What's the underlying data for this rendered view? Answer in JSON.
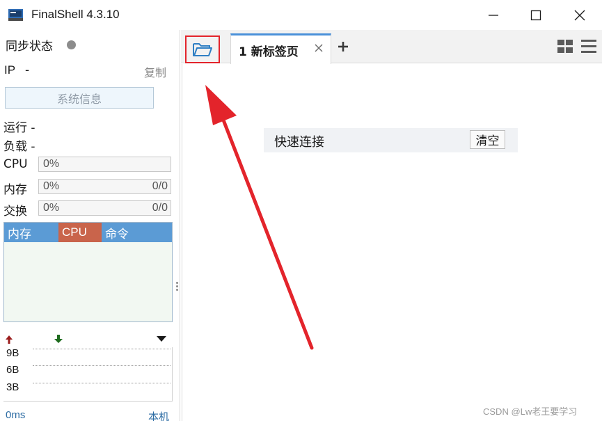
{
  "window": {
    "title": "FinalShell 4.3.10",
    "app_icon": "terminal-monitor-icon"
  },
  "left": {
    "sync_label": "同步状态",
    "sync_status_color": "#8c8c8c",
    "ip_label": "IP",
    "ip_value": "-",
    "copy_label": "复制",
    "sysinfo_button": "系统信息",
    "run_label": "运行 -",
    "load_label": "负载 -",
    "metrics": [
      {
        "label": "CPU",
        "percent": "0%",
        "ratio": ""
      },
      {
        "label": "内存",
        "percent": "0%",
        "ratio": "0/0"
      },
      {
        "label": "交换",
        "percent": "0%",
        "ratio": "0/0"
      }
    ],
    "process_columns": [
      "内存",
      "CPU",
      "命令"
    ],
    "network": {
      "labels": [
        "9B",
        "6B",
        "3B"
      ],
      "upload_icon": "arrow-up-icon",
      "download_icon": "arrow-down-icon",
      "upload_color": "#9b1c1c",
      "download_color": "#1e6b1e"
    },
    "latency": "0ms",
    "host_link": "本机"
  },
  "tabs": {
    "open_icon": "folder-open-icon",
    "items": [
      {
        "label": "1 新标签页"
      }
    ],
    "accent": "#4a90d9"
  },
  "content": {
    "quick_connect_label": "快速连接",
    "clear_button": "清空"
  },
  "annotation": {
    "color": "#e3242b"
  },
  "watermark": "CSDN @Lw老王要学习"
}
